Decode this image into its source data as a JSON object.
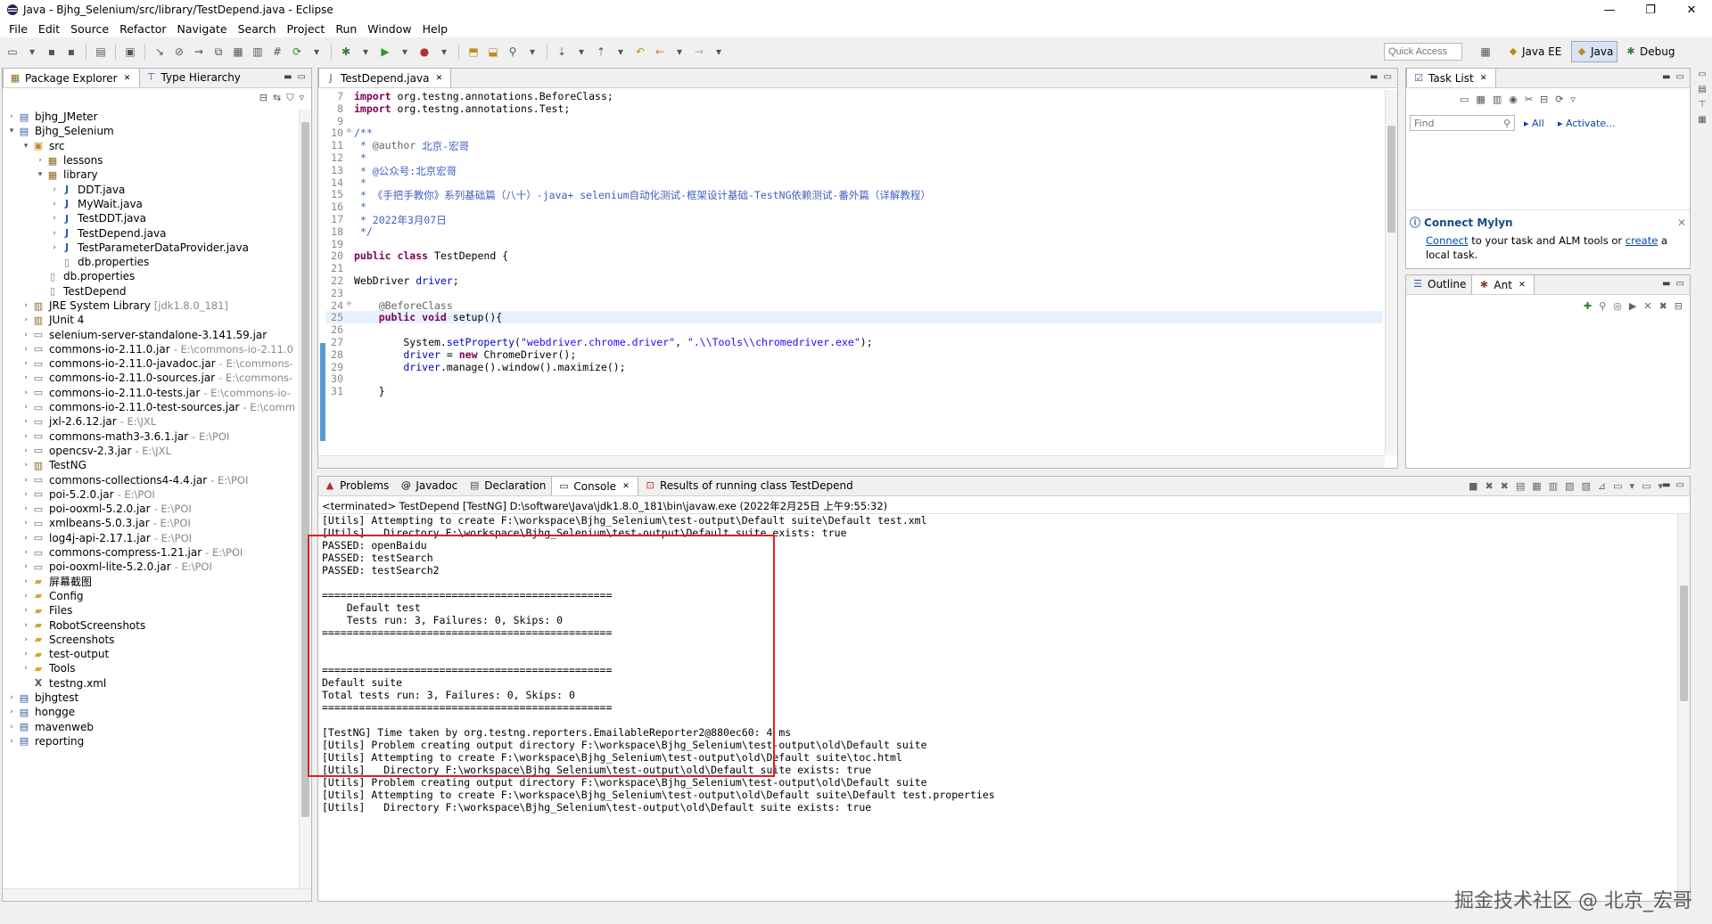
{
  "window": {
    "title": "Java - Bjhg_Selenium/src/library/TestDepend.java - Eclipse",
    "controls": [
      "—",
      "❐",
      "✕"
    ]
  },
  "menu": [
    "File",
    "Edit",
    "Source",
    "Refactor",
    "Navigate",
    "Search",
    "Project",
    "Run",
    "Window",
    "Help"
  ],
  "quick_access": {
    "placeholder": "Quick Access"
  },
  "perspectives": [
    {
      "label": "Java EE",
      "active": false
    },
    {
      "label": "Java",
      "active": true
    },
    {
      "label": "Debug",
      "active": false
    }
  ],
  "package_explorer": {
    "tabs": [
      "Package Explorer",
      "Type Hierarchy"
    ],
    "items": [
      {
        "label": "bjhg_JMeter",
        "decoration": "",
        "depth": 0,
        "twisty": ">",
        "icon": "project"
      },
      {
        "label": "Bjhg_Selenium",
        "decoration": "",
        "depth": 0,
        "twisty": "v",
        "icon": "project"
      },
      {
        "label": "src",
        "decoration": "",
        "depth": 1,
        "twisty": "v",
        "icon": "srcfolder"
      },
      {
        "label": "lessons",
        "decoration": "",
        "depth": 2,
        "twisty": ">",
        "icon": "package"
      },
      {
        "label": "library",
        "decoration": "",
        "depth": 2,
        "twisty": "v",
        "icon": "package"
      },
      {
        "label": "DDT.java",
        "decoration": "",
        "depth": 3,
        "twisty": ">",
        "icon": "java"
      },
      {
        "label": "MyWait.java",
        "decoration": "",
        "depth": 3,
        "twisty": ">",
        "icon": "java"
      },
      {
        "label": "TestDDT.java",
        "decoration": "",
        "depth": 3,
        "twisty": ">",
        "icon": "java"
      },
      {
        "label": "TestDepend.java",
        "decoration": "",
        "depth": 3,
        "twisty": ">",
        "icon": "java"
      },
      {
        "label": "TestParameterDataProvider.java",
        "decoration": "",
        "depth": 3,
        "twisty": ">",
        "icon": "java"
      },
      {
        "label": "db.properties",
        "decoration": "",
        "depth": 3,
        "twisty": "",
        "icon": "file"
      },
      {
        "label": "db.properties",
        "decoration": "",
        "depth": 2,
        "twisty": "",
        "icon": "file"
      },
      {
        "label": "TestDepend",
        "decoration": "",
        "depth": 2,
        "twisty": "",
        "icon": "file"
      },
      {
        "label": "JRE System Library",
        "decoration": "[jdk1.8.0_181]",
        "depth": 1,
        "twisty": ">",
        "icon": "library"
      },
      {
        "label": "JUnit 4",
        "decoration": "",
        "depth": 1,
        "twisty": ">",
        "icon": "library"
      },
      {
        "label": "selenium-server-standalone-3.141.59.jar",
        "decoration": "",
        "depth": 1,
        "twisty": ">",
        "icon": "jar"
      },
      {
        "label": "commons-io-2.11.0.jar",
        "decoration": "- E:\\commons-io-2.11.0",
        "depth": 1,
        "twisty": ">",
        "icon": "jar"
      },
      {
        "label": "commons-io-2.11.0-javadoc.jar",
        "decoration": "- E:\\commons-",
        "depth": 1,
        "twisty": ">",
        "icon": "jar"
      },
      {
        "label": "commons-io-2.11.0-sources.jar",
        "decoration": "- E:\\commons-",
        "depth": 1,
        "twisty": ">",
        "icon": "jar"
      },
      {
        "label": "commons-io-2.11.0-tests.jar",
        "decoration": "- E:\\commons-io-",
        "depth": 1,
        "twisty": ">",
        "icon": "jar"
      },
      {
        "label": "commons-io-2.11.0-test-sources.jar",
        "decoration": "- E:\\comm",
        "depth": 1,
        "twisty": ">",
        "icon": "jar"
      },
      {
        "label": "jxl-2.6.12.jar",
        "decoration": "- E:\\JXL",
        "depth": 1,
        "twisty": ">",
        "icon": "jar"
      },
      {
        "label": "commons-math3-3.6.1.jar",
        "decoration": "- E:\\POI",
        "depth": 1,
        "twisty": ">",
        "icon": "jar"
      },
      {
        "label": "opencsv-2.3.jar",
        "decoration": "- E:\\JXL",
        "depth": 1,
        "twisty": ">",
        "icon": "jar"
      },
      {
        "label": "TestNG",
        "decoration": "",
        "depth": 1,
        "twisty": ">",
        "icon": "library"
      },
      {
        "label": "commons-collections4-4.4.jar",
        "decoration": "- E:\\POI",
        "depth": 1,
        "twisty": ">",
        "icon": "jar"
      },
      {
        "label": "poi-5.2.0.jar",
        "decoration": "- E:\\POI",
        "depth": 1,
        "twisty": ">",
        "icon": "jar"
      },
      {
        "label": "poi-ooxml-5.2.0.jar",
        "decoration": "- E:\\POI",
        "depth": 1,
        "twisty": ">",
        "icon": "jar"
      },
      {
        "label": "xmlbeans-5.0.3.jar",
        "decoration": "- E:\\POI",
        "depth": 1,
        "twisty": ">",
        "icon": "jar"
      },
      {
        "label": "log4j-api-2.17.1.jar",
        "decoration": "- E:\\POI",
        "depth": 1,
        "twisty": ">",
        "icon": "jar"
      },
      {
        "label": "commons-compress-1.21.jar",
        "decoration": "- E:\\POI",
        "depth": 1,
        "twisty": ">",
        "icon": "jar"
      },
      {
        "label": "poi-ooxml-lite-5.2.0.jar",
        "decoration": "- E:\\POI",
        "depth": 1,
        "twisty": ">",
        "icon": "jar"
      },
      {
        "label": "屏幕截图",
        "decoration": "",
        "depth": 1,
        "twisty": ">",
        "icon": "folder"
      },
      {
        "label": "Config",
        "decoration": "",
        "depth": 1,
        "twisty": ">",
        "icon": "folder"
      },
      {
        "label": "Files",
        "decoration": "",
        "depth": 1,
        "twisty": ">",
        "icon": "folder"
      },
      {
        "label": "RobotScreenshots",
        "decoration": "",
        "depth": 1,
        "twisty": ">",
        "icon": "folder"
      },
      {
        "label": "Screenshots",
        "decoration": "",
        "depth": 1,
        "twisty": ">",
        "icon": "folder"
      },
      {
        "label": "test-output",
        "decoration": "",
        "depth": 1,
        "twisty": ">",
        "icon": "folder"
      },
      {
        "label": "Tools",
        "decoration": "",
        "depth": 1,
        "twisty": ">",
        "icon": "folder"
      },
      {
        "label": "testng.xml",
        "decoration": "",
        "depth": 1,
        "twisty": "",
        "icon": "xml"
      },
      {
        "label": "bjhgtest",
        "decoration": "",
        "depth": 0,
        "twisty": ">",
        "icon": "project"
      },
      {
        "label": "hongge",
        "decoration": "",
        "depth": 0,
        "twisty": ">",
        "icon": "project"
      },
      {
        "label": "mavenweb",
        "decoration": "",
        "depth": 0,
        "twisty": ">",
        "icon": "project"
      },
      {
        "label": "reporting",
        "decoration": "",
        "depth": 0,
        "twisty": ">",
        "icon": "project"
      }
    ]
  },
  "editor": {
    "tab": "TestDepend.java",
    "lines": [
      {
        "n": "7",
        "parts": [
          [
            "kw",
            "import"
          ],
          [
            "sy",
            " org.testng.annotations.BeforeClass;"
          ]
        ]
      },
      {
        "n": "8",
        "parts": [
          [
            "kw",
            "import"
          ],
          [
            "sy",
            " org.testng.annotations.Test;"
          ]
        ]
      },
      {
        "n": "9",
        "parts": []
      },
      {
        "n": "10",
        "fold": true,
        "parts": [
          [
            "cm",
            "/**"
          ]
        ]
      },
      {
        "n": "11",
        "parts": [
          [
            "cm",
            " * "
          ],
          [
            "an",
            "@author"
          ],
          [
            "cm",
            " 北京-宏哥"
          ]
        ]
      },
      {
        "n": "12",
        "parts": [
          [
            "cm",
            " *"
          ]
        ]
      },
      {
        "n": "13",
        "parts": [
          [
            "cm",
            " * @公众号:北京宏哥"
          ]
        ]
      },
      {
        "n": "14",
        "parts": [
          [
            "cm",
            " *"
          ]
        ]
      },
      {
        "n": "15",
        "parts": [
          [
            "cm",
            " * 《手把手教你》系列基础篇（八十）-java+ selenium自动化测试-框架设计基础-TestNG依赖测试-番外篇（详解教程）"
          ]
        ]
      },
      {
        "n": "16",
        "parts": [
          [
            "cm",
            " *"
          ]
        ]
      },
      {
        "n": "17",
        "parts": [
          [
            "cm",
            " * 2022年3月07日"
          ]
        ]
      },
      {
        "n": "18",
        "parts": [
          [
            "cm",
            " */"
          ]
        ]
      },
      {
        "n": "19",
        "parts": []
      },
      {
        "n": "20",
        "parts": [
          [
            "kw",
            "public class"
          ],
          [
            "sy",
            " TestDepend {"
          ]
        ]
      },
      {
        "n": "21",
        "parts": []
      },
      {
        "n": "22",
        "parts": [
          [
            "sy",
            "WebDriver "
          ],
          [
            "fd",
            "driver"
          ],
          [
            "sy",
            ";"
          ]
        ]
      },
      {
        "n": "23",
        "parts": []
      },
      {
        "n": "24",
        "fold": true,
        "parts": [
          [
            "an",
            "    @BeforeClass"
          ]
        ]
      },
      {
        "n": "25",
        "current": true,
        "parts": [
          [
            "kw",
            "    public void"
          ],
          [
            "sy",
            " setup(){"
          ]
        ]
      },
      {
        "n": "26",
        "parts": []
      },
      {
        "n": "27",
        "parts": [
          [
            "sy",
            "        System."
          ],
          [
            "fd",
            "setProperty"
          ],
          [
            "sy",
            "("
          ],
          [
            "st",
            "\"webdriver.chrome.driver\""
          ],
          [
            "sy",
            ", "
          ],
          [
            "st",
            "\".\\\\Tools\\\\chromedriver.exe\""
          ],
          [
            "sy",
            ");"
          ]
        ]
      },
      {
        "n": "28",
        "parts": [
          [
            "fd",
            "        driver"
          ],
          [
            "sy",
            " = "
          ],
          [
            "kw",
            "new"
          ],
          [
            "sy",
            " ChromeDriver();"
          ]
        ]
      },
      {
        "n": "29",
        "parts": [
          [
            "fd",
            "        driver"
          ],
          [
            "sy",
            ".manage().window().maximize();"
          ]
        ]
      },
      {
        "n": "30",
        "parts": []
      },
      {
        "n": "31",
        "parts": [
          [
            "sy",
            "    }"
          ]
        ]
      }
    ]
  },
  "task_list": {
    "tab": "Task List",
    "find_placeholder": "Find",
    "filter_all": "All",
    "activate": "Activate...",
    "connect_title": "Connect Mylyn",
    "connect_link": "Connect",
    "connect_text": " to your task and ALM tools or ",
    "create_link": "create",
    "connect_text2": " a local task."
  },
  "outline": {
    "tabs": [
      "Outline",
      "Ant"
    ]
  },
  "console": {
    "tabs": [
      "Problems",
      "Javadoc",
      "Declaration",
      "Console",
      "Results of running class TestDepend"
    ],
    "status": "<terminated> TestDepend [TestNG] D:\\software\\Java\\jdk1.8.0_181\\bin\\javaw.exe (2022年2月25日 上午9:55:32)",
    "lines": [
      "[Utils] Attempting to create F:\\workspace\\Bjhg_Selenium\\test-output\\Default suite\\Default test.xml",
      "[Utils]   Directory F:\\workspace\\Bjhg_Selenium\\test-output\\Default suite exists: true",
      "PASSED: openBaidu",
      "PASSED: testSearch",
      "PASSED: testSearch2",
      "",
      "===============================================",
      "    Default test",
      "    Tests run: 3, Failures: 0, Skips: 0",
      "===============================================",
      "",
      "",
      "===============================================",
      "Default suite",
      "Total tests run: 3, Failures: 0, Skips: 0",
      "===============================================",
      "",
      "[TestNG] Time taken by org.testng.reporters.EmailableReporter2@880ec60: 4 ms",
      "[Utils] Problem creating output directory F:\\workspace\\Bjhg_Selenium\\test-output\\old\\Default suite",
      "[Utils] Attempting to create F:\\workspace\\Bjhg_Selenium\\test-output\\old\\Default suite\\toc.html",
      "[Utils]   Directory F:\\workspace\\Bjhg_Selenium\\test-output\\old\\Default suite exists: true",
      "[Utils] Problem creating output directory F:\\workspace\\Bjhg_Selenium\\test-output\\old\\Default suite",
      "[Utils] Attempting to create F:\\workspace\\Bjhg_Selenium\\test-output\\old\\Default suite\\Default test.properties",
      "[Utils]   Directory F:\\workspace\\Bjhg_Selenium\\test-output\\old\\Default suite exists: true"
    ]
  },
  "watermark": "掘金技术社区 @ 北京_宏哥",
  "colors": {
    "highlight_box": "#e02020",
    "keyword": "#7f0055",
    "comment": "#3f5fbf",
    "string": "#2a00ff",
    "field": "#0000c0"
  }
}
